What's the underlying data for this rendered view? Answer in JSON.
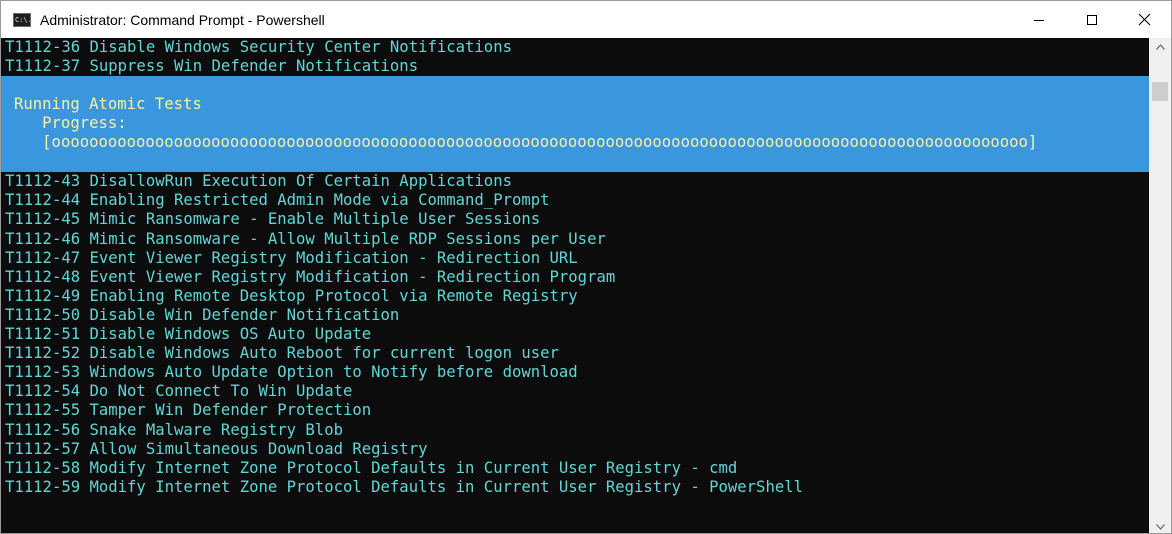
{
  "window": {
    "title": "Administrator: Command Prompt - Powershell",
    "icon_label": "C:\\."
  },
  "controls": [
    "minimize-icon",
    "maximize-icon",
    "close-icon"
  ],
  "console": {
    "lines_before": [
      "T1112-36 Disable Windows Security Center Notifications",
      "T1112-37 Suppress Win Defender Notifications"
    ],
    "progress": {
      "title": "Running Atomic Tests",
      "label": "   Progress:",
      "bar": "   [oooooooooooooooooooooooooooooooooooooooooooooooooooooooooooooooooooooooooooooooooooooooooooooooooooooooo]"
    },
    "lines_after": [
      "T1112-43 DisallowRun Execution Of Certain Applications",
      "T1112-44 Enabling Restricted Admin Mode via Command_Prompt",
      "T1112-45 Mimic Ransomware - Enable Multiple User Sessions",
      "T1112-46 Mimic Ransomware - Allow Multiple RDP Sessions per User",
      "T1112-47 Event Viewer Registry Modification - Redirection URL",
      "T1112-48 Event Viewer Registry Modification - Redirection Program",
      "T1112-49 Enabling Remote Desktop Protocol via Remote Registry",
      "T1112-50 Disable Win Defender Notification",
      "T1112-51 Disable Windows OS Auto Update",
      "T1112-52 Disable Windows Auto Reboot for current logon user",
      "T1112-53 Windows Auto Update Option to Notify before download",
      "T1112-54 Do Not Connect To Win Update",
      "T1112-55 Tamper Win Defender Protection",
      "T1112-56 Snake Malware Registry Blob",
      "T1112-57 Allow Simultaneous Download Registry",
      "T1112-58 Modify Internet Zone Protocol Defaults in Current User Registry - cmd",
      "T1112-59 Modify Internet Zone Protocol Defaults in Current User Registry - PowerShell"
    ]
  },
  "colors": {
    "console_bg": "#0c0c0c",
    "text_cyan": "#61d6d6",
    "progress_bg": "#3a96dd",
    "progress_text": "#f9f1a5"
  }
}
